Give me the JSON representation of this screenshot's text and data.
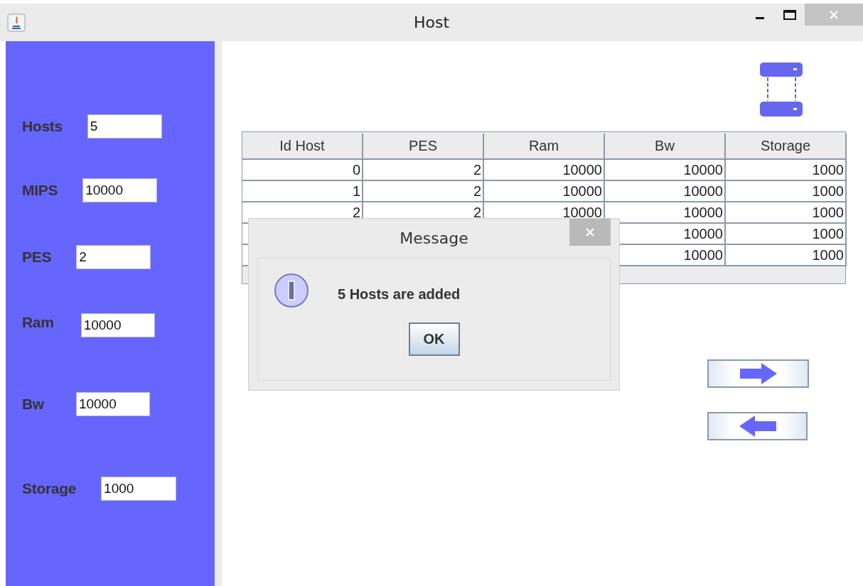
{
  "window": {
    "title": "Host"
  },
  "form": [
    {
      "label": "Hosts",
      "value": "5"
    },
    {
      "label": "MIPS",
      "value": "10000"
    },
    {
      "label": "PES",
      "value": "2"
    },
    {
      "label": "Ram",
      "value": "10000"
    },
    {
      "label": "Bw",
      "value": "10000"
    },
    {
      "label": "Storage",
      "value": "1000"
    }
  ],
  "table": {
    "columns": [
      "Id Host",
      "PES",
      "Ram",
      "Bw",
      "Storage"
    ],
    "rows": [
      [
        "0",
        "2",
        "10000",
        "10000",
        "1000"
      ],
      [
        "1",
        "2",
        "10000",
        "10000",
        "1000"
      ],
      [
        "2",
        "2",
        "10000",
        "10000",
        "1000"
      ],
      [
        null,
        null,
        null,
        "10000",
        "1000"
      ],
      [
        null,
        null,
        null,
        "10000",
        "1000"
      ]
    ]
  },
  "dialog": {
    "title": "Message",
    "message": "5 Hosts are added",
    "button": "OK"
  }
}
